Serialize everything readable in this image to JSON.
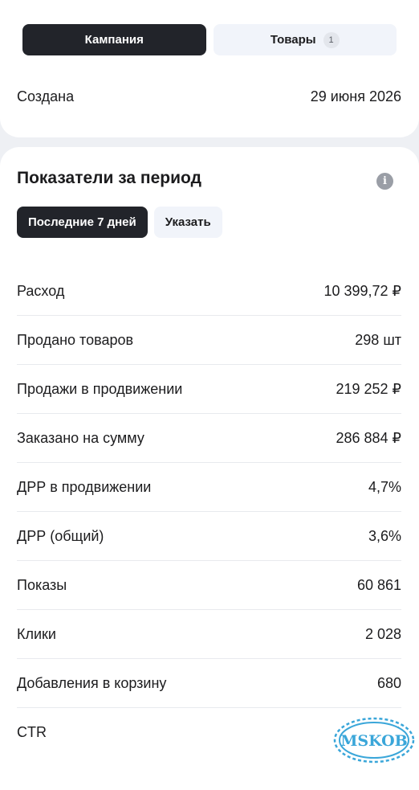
{
  "tabs": [
    {
      "label": "Кампания",
      "active": true
    },
    {
      "label": "Товары",
      "badge": "1",
      "active": false
    }
  ],
  "created": {
    "label": "Создана",
    "value": "29 июня 2026"
  },
  "stats": {
    "title": "Показатели за период",
    "info_icon": "info-icon",
    "period_options": [
      {
        "label": "Последние 7 дней",
        "active": true
      },
      {
        "label": "Указать",
        "active": false
      }
    ],
    "metrics": [
      {
        "label": "Расход",
        "value": "10 399,72 ₽"
      },
      {
        "label": "Продано товаров",
        "value": "298 шт"
      },
      {
        "label": "Продажи в продвижении",
        "value": "219 252 ₽"
      },
      {
        "label": "Заказано на сумму",
        "value": "286 884 ₽"
      },
      {
        "label": "ДРР в продвижении",
        "value": "4,7%"
      },
      {
        "label": "ДРР (общий)",
        "value": "3,6%"
      },
      {
        "label": "Показы",
        "value": "60 861"
      },
      {
        "label": "Клики",
        "value": "2 028"
      },
      {
        "label": "Добавления в корзину",
        "value": "680"
      },
      {
        "label": "CTR",
        "value": "%"
      }
    ]
  },
  "watermark": {
    "text": "MSKOB"
  },
  "colors": {
    "dark": "#22242a",
    "chip_bg": "#f1f4fa",
    "page_bg": "#eef0f4",
    "watermark": "#3aa6d9"
  }
}
